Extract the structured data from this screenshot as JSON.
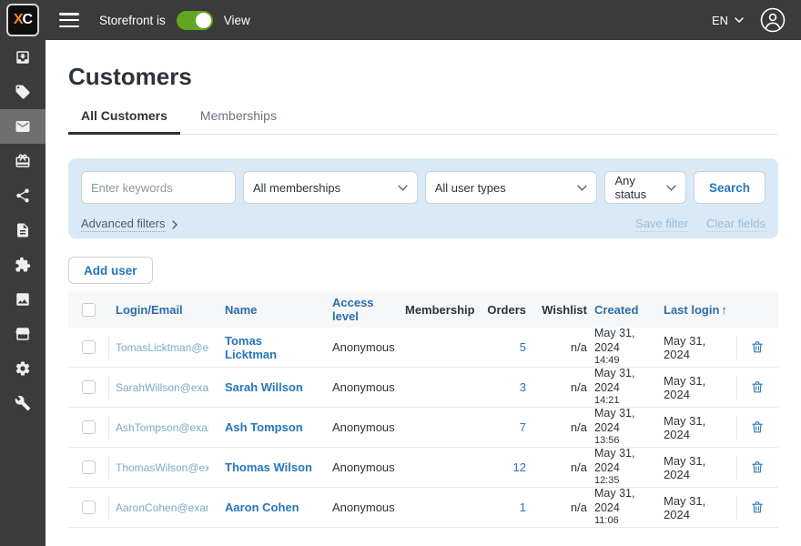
{
  "topbar": {
    "logo_text_x": "X",
    "logo_text_c": "C",
    "storefront_label": "Storefront is",
    "toggle_state": "on",
    "view_label": "View",
    "language": "EN"
  },
  "sidebar": {
    "items": [
      {
        "icon": "inbox-arrow-icon",
        "active": false
      },
      {
        "icon": "tag-icon",
        "active": false
      },
      {
        "icon": "envelope-icon",
        "active": true
      },
      {
        "icon": "gift-icon",
        "active": false
      },
      {
        "icon": "share-nodes-icon",
        "active": false
      },
      {
        "icon": "document-icon",
        "active": false
      },
      {
        "icon": "puzzle-icon",
        "active": false
      },
      {
        "icon": "image-icon",
        "active": false
      },
      {
        "icon": "storefront-icon",
        "active": false
      },
      {
        "icon": "gear-icon",
        "active": false
      },
      {
        "icon": "wrench-icon",
        "active": false
      }
    ]
  },
  "page": {
    "title": "Customers",
    "tabs": [
      {
        "label": "All Customers",
        "active": true
      },
      {
        "label": "Memberships",
        "active": false
      }
    ]
  },
  "filters": {
    "keywords_placeholder": "Enter keywords",
    "memberships_value": "All memberships",
    "user_types_value": "All user types",
    "status_value": "Any status",
    "search_label": "Search",
    "advanced_filters_label": "Advanced filters",
    "save_filter_label": "Save filter",
    "clear_fields_label": "Clear fields"
  },
  "actions": {
    "add_user_label": "Add user"
  },
  "table": {
    "columns": [
      {
        "label": "Login/Email"
      },
      {
        "label": "Name"
      },
      {
        "label": "Access level"
      },
      {
        "label": "Membership"
      },
      {
        "label": "Orders"
      },
      {
        "label": "Wishlist"
      },
      {
        "label": "Created"
      },
      {
        "label": "Last login",
        "sorted": "asc",
        "sort_arrow": "↑"
      }
    ],
    "rows": [
      {
        "email": "TomasLicktman@ex...",
        "name": "Tomas Licktman",
        "access_level": "Anonymous",
        "membership": "",
        "orders": "5",
        "wishlist": "n/a",
        "created_date": "May 31, 2024",
        "created_time": "14:49",
        "last_login": "May 31, 2024"
      },
      {
        "email": "SarahWillson@exam...",
        "name": "Sarah Willson",
        "access_level": "Anonymous",
        "membership": "",
        "orders": "3",
        "wishlist": "n/a",
        "created_date": "May 31, 2024",
        "created_time": "14:21",
        "last_login": "May 31, 2024"
      },
      {
        "email": "AshTompson@exam...",
        "name": "Ash Tompson",
        "access_level": "Anonymous",
        "membership": "",
        "orders": "7",
        "wishlist": "n/a",
        "created_date": "May 31, 2024",
        "created_time": "13:56",
        "last_login": "May 31, 2024"
      },
      {
        "email": "ThomasWilson@exa...",
        "name": "Thomas Wilson",
        "access_level": "Anonymous",
        "membership": "",
        "orders": "12",
        "wishlist": "n/a",
        "created_date": "May 31, 2024",
        "created_time": "12:35",
        "last_login": "May 31, 2024"
      },
      {
        "email": "AaronCohen@exam...",
        "name": "Aaron Cohen",
        "access_level": "Anonymous",
        "membership": "",
        "orders": "1",
        "wishlist": "n/a",
        "created_date": "May 31, 2024",
        "created_time": "11:06",
        "last_login": "May 31, 2024"
      }
    ]
  },
  "colors": {
    "topbar_bg": "#3b3b3b",
    "sidebar_active_bg": "#6f6f6f",
    "toggle_green": "#61a521",
    "accent_blue": "#2776bb",
    "email_blue": "#7aa9cc",
    "filter_panel_bg": "#d9e9f6"
  }
}
